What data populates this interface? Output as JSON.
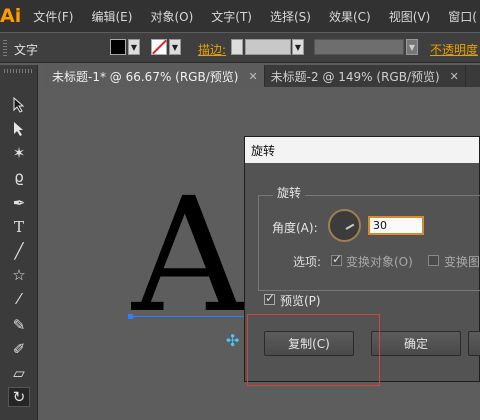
{
  "app": {
    "logo": "Ai"
  },
  "menu": [
    "文件(F)",
    "编辑(E)",
    "对象(O)",
    "文字(T)",
    "选择(S)",
    "效果(C)",
    "视图(V)",
    "窗口("
  ],
  "control_bar": {
    "tool_label": "文字",
    "stroke_label": "描边:",
    "opacity_label": "不透明度"
  },
  "tabs": [
    {
      "label": "未标题-1* @ 66.67% (RGB/预览)",
      "close": "✕",
      "active": true
    },
    {
      "label": "未标题-2 @ 149% (RGB/预览)",
      "close": "✕",
      "active": false
    }
  ],
  "canvas": {
    "glyph": "A"
  },
  "dialog": {
    "title": "旋转",
    "group_label": "旋转",
    "angle_label": "角度(A):",
    "angle_value": "30",
    "options_label": "选项:",
    "transform_objects": "变换对象(O)",
    "transform_objects_checked": true,
    "transform_patterns": "变换图",
    "transform_patterns_checked": false,
    "preview_label": "预览(P)",
    "preview_checked": true,
    "buttons": {
      "copy": "复制(C)",
      "ok": "确定"
    }
  },
  "colors": {
    "accent": "#ff9a00",
    "focus": "#d98a2b",
    "selection": "#2f80ff",
    "highlight": "#d94040"
  }
}
